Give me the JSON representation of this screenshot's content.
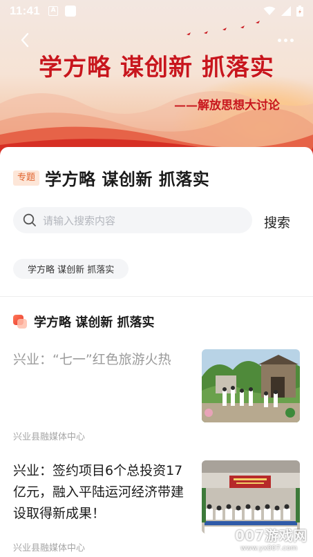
{
  "status_bar": {
    "time": "11:41",
    "a_icon": "A"
  },
  "banner": {
    "title": "学方略 谋创新 抓落实",
    "subtitle": "——解放思想大讨论"
  },
  "topic": {
    "tag": "专题",
    "title": "学方略 谋创新 抓落实"
  },
  "search": {
    "placeholder": "请输入搜索内容",
    "button": "搜索"
  },
  "chip": "学方略 谋创新 抓落实",
  "section": {
    "title": "学方略 谋创新 抓落实"
  },
  "news": [
    {
      "title": "兴业：“七一”红色旅游火热",
      "source": "兴业县融媒体中心",
      "read": true
    },
    {
      "title": "兴业：签约项目6个总投资17亿元，融入平陆运河经济带建设取得新成果！",
      "source": "兴业县融媒体中心",
      "read": false
    }
  ],
  "watermark": {
    "big": "007游戏网",
    "small": "www.yx007.com"
  },
  "colors": {
    "accent_red": "#c8161d",
    "tag_orange": "#e0622d"
  },
  "icons": [
    "back-arrow-icon",
    "more-dots-icon",
    "search-icon",
    "wifi-icon",
    "cellular-icon",
    "battery-icon",
    "section-icon"
  ]
}
